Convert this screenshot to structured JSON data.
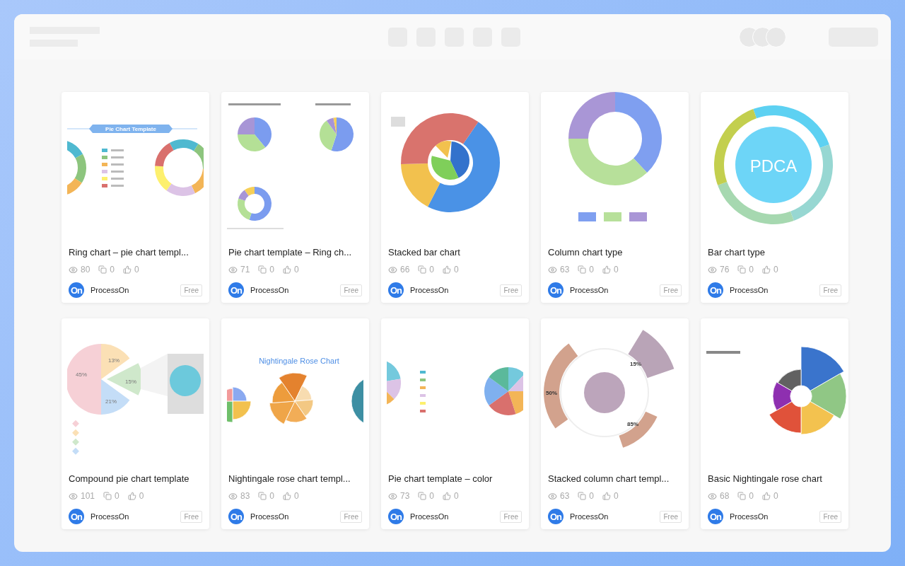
{
  "cards": [
    {
      "title": "Ring chart – pie chart templ...",
      "thumbnail": {
        "kind": "ring-pie",
        "labels": [
          "Pie Chart Template"
        ]
      },
      "views": "80",
      "copies": "0",
      "likes": "0",
      "author": {
        "logo": "On",
        "name": "ProcessOn"
      },
      "badge": "Free"
    },
    {
      "title": "Pie chart template – Ring ch...",
      "thumbnail": {
        "kind": "multi-pie"
      },
      "views": "71",
      "copies": "0",
      "likes": "0",
      "author": {
        "logo": "On",
        "name": "ProcessOn"
      },
      "badge": "Free"
    },
    {
      "title": "Stacked bar chart",
      "thumbnail": {
        "kind": "stacked-ring"
      },
      "views": "66",
      "copies": "0",
      "likes": "0",
      "author": {
        "logo": "On",
        "name": "ProcessOn"
      },
      "badge": "Free"
    },
    {
      "title": "Column chart type",
      "thumbnail": {
        "kind": "donut"
      },
      "views": "63",
      "copies": "0",
      "likes": "0",
      "author": {
        "logo": "On",
        "name": "ProcessOn"
      },
      "badge": "Free"
    },
    {
      "title": "Bar chart type",
      "thumbnail": {
        "kind": "pdca",
        "labels": [
          "PDCA"
        ]
      },
      "views": "76",
      "copies": "0",
      "likes": "0",
      "author": {
        "logo": "On",
        "name": "ProcessOn"
      },
      "badge": "Free"
    },
    {
      "title": "Compound pie chart template",
      "thumbnail": {
        "kind": "compound-pie",
        "labels": [
          "45%",
          "13%",
          "15%",
          "21%"
        ]
      },
      "views": "101",
      "copies": "0",
      "likes": "0",
      "author": {
        "logo": "On",
        "name": "ProcessOn"
      },
      "badge": "Free"
    },
    {
      "title": "Nightingale rose chart templ...",
      "thumbnail": {
        "kind": "rose",
        "labels": [
          "Nightingale Rose Chart"
        ]
      },
      "views": "83",
      "copies": "0",
      "likes": "0",
      "author": {
        "logo": "On",
        "name": "ProcessOn"
      },
      "badge": "Free"
    },
    {
      "title": "Pie chart template – color",
      "thumbnail": {
        "kind": "pie-color"
      },
      "views": "73",
      "copies": "0",
      "likes": "0",
      "author": {
        "logo": "On",
        "name": "ProcessOn"
      },
      "badge": "Free"
    },
    {
      "title": "Stacked column chart templ...",
      "thumbnail": {
        "kind": "radial-bar",
        "labels": [
          "15%",
          "50%",
          "85%"
        ]
      },
      "views": "63",
      "copies": "0",
      "likes": "0",
      "author": {
        "logo": "On",
        "name": "ProcessOn"
      },
      "badge": "Free"
    },
    {
      "title": "Basic Nightingale rose chart",
      "thumbnail": {
        "kind": "basic-rose"
      },
      "views": "68",
      "copies": "0",
      "likes": "0",
      "author": {
        "logo": "On",
        "name": "ProcessOn"
      },
      "badge": "Free"
    }
  ]
}
